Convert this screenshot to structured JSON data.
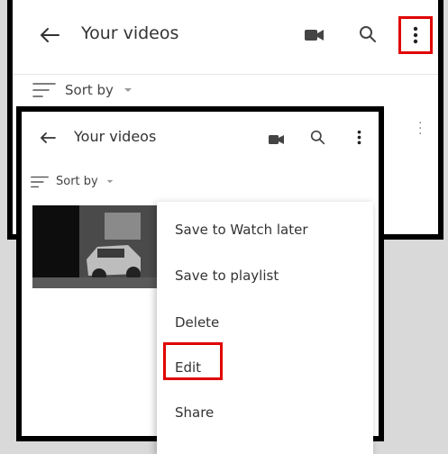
{
  "top_screen": {
    "title": "Your videos",
    "sort_label": "Sort by"
  },
  "front_screen": {
    "title": "Your videos",
    "sort_label": "Sort by",
    "menu_items": [
      {
        "label": "Save to Watch later"
      },
      {
        "label": "Save to playlist"
      },
      {
        "label": "Delete"
      },
      {
        "label": "Edit"
      },
      {
        "label": "Share"
      }
    ]
  },
  "colors": {
    "highlight": "#e00000",
    "panel_border": "#000000",
    "background": "#d9d9d9"
  },
  "icons": [
    "back-arrow-icon",
    "video-camera-icon",
    "search-icon",
    "more-vertical-icon",
    "sort-icon",
    "dropdown-arrow-icon"
  ]
}
